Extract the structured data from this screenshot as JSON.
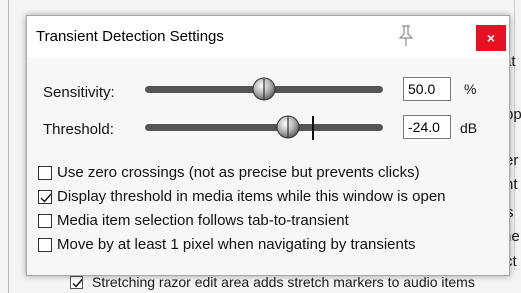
{
  "background_window": {
    "fragments": [
      "at",
      "pp",
      "er",
      "nt",
      "s",
      "he",
      "ct"
    ],
    "bottom_checkbox": {
      "checked": true,
      "label": "Stretching razor edit area adds stretch markers to audio items"
    }
  },
  "dialog": {
    "title": "Transient Detection Settings",
    "close_label": "×",
    "sensitivity": {
      "label": "Sensitivity:",
      "value": "50.0",
      "unit": "%",
      "level": 0.5
    },
    "threshold": {
      "label": "Threshold:",
      "value": "-24.0",
      "unit": "dB",
      "level": 0.6
    },
    "options": [
      {
        "label": "Use zero crossings (not as precise but prevents clicks)",
        "checked": false
      },
      {
        "label": "Display threshold in media items while this window is open",
        "checked": true
      },
      {
        "label": "Media item selection follows tab-to-transient",
        "checked": false
      },
      {
        "label": "Move by at least 1 pixel when navigating by transients",
        "checked": false
      }
    ]
  },
  "colors": {
    "close_button": "#e81123",
    "track": "#555555"
  }
}
